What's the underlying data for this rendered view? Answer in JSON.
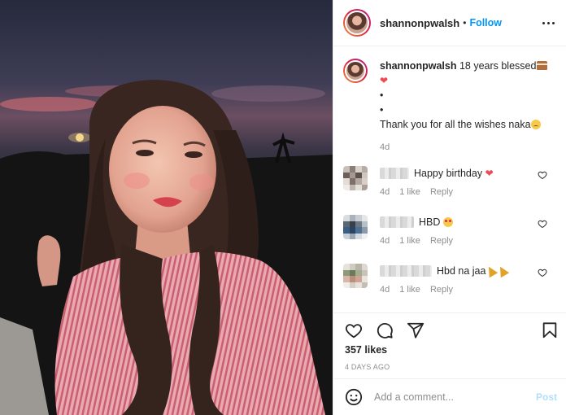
{
  "header": {
    "username": "shannonpwalsh",
    "separator": "•",
    "follow_label": "Follow"
  },
  "caption": {
    "username": "shannonpwalsh",
    "text": "18 years blessed",
    "bullet1": "•",
    "bullet2": "•",
    "thanks": "Thank you for all the wishes naka",
    "time": "4d"
  },
  "comments": [
    {
      "text": "Happy birthday",
      "time": "4d",
      "likes": "1 like",
      "reply": "Reply"
    },
    {
      "text": "HBD",
      "time": "4d",
      "likes": "1 like",
      "reply": "Reply"
    },
    {
      "text": "Hbd na jaa",
      "time": "4d",
      "likes": "1 like",
      "reply": "Reply"
    }
  ],
  "likes_label": "357 likes",
  "posted_ago": "4 DAYS AGO",
  "comment_box": {
    "placeholder": "Add a comment...",
    "post_label": "Post"
  },
  "colors": {
    "accent": "#0095f6",
    "post_disabled": "#b2dffc",
    "heart": "#ed4956",
    "muted": "#8e8e8e"
  },
  "icons": [
    "more-icon",
    "heart-icon",
    "comment-icon",
    "share-icon",
    "bookmark-icon",
    "emoji-icon"
  ]
}
